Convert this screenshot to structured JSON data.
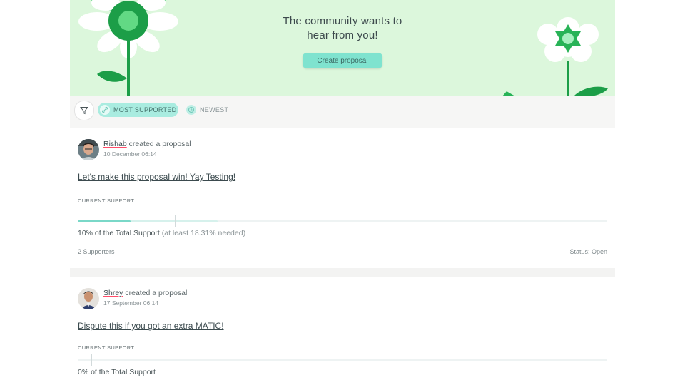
{
  "hero": {
    "title_line1": "The community wants to",
    "title_line2": "hear from you!",
    "create_button": "Create proposal",
    "colors": {
      "banner": "#dcf7dc",
      "leaf": "#1c9e48",
      "button": "#7fe3cf"
    }
  },
  "filters": {
    "filter_icon": "filter-icon",
    "most_supported": "MOST SUPPORTED",
    "newest": "NEWEST",
    "active": "MOST SUPPORTED"
  },
  "proposals": [
    {
      "author": "Rishab",
      "action": "created a proposal",
      "date": "10 December 06:14",
      "title": "Let's make this proposal win! Yay Testing!",
      "current_support_label": "CURRENT SUPPORT",
      "support_text": "10% of the Total Support",
      "needed_text": "(at least 18.31% needed)",
      "support_fraction": 0.1,
      "required_fraction": 0.1831,
      "supporters": "2 Supporters",
      "status": "Status: Open"
    },
    {
      "author": "Shrey",
      "action": "created a proposal",
      "date": "17 September 06:14",
      "title": "Dispute this if you got an extra MATIC!",
      "current_support_label": "CURRENT SUPPORT",
      "support_text": "0% of the Total Support",
      "support_fraction": 0.0
    }
  ]
}
